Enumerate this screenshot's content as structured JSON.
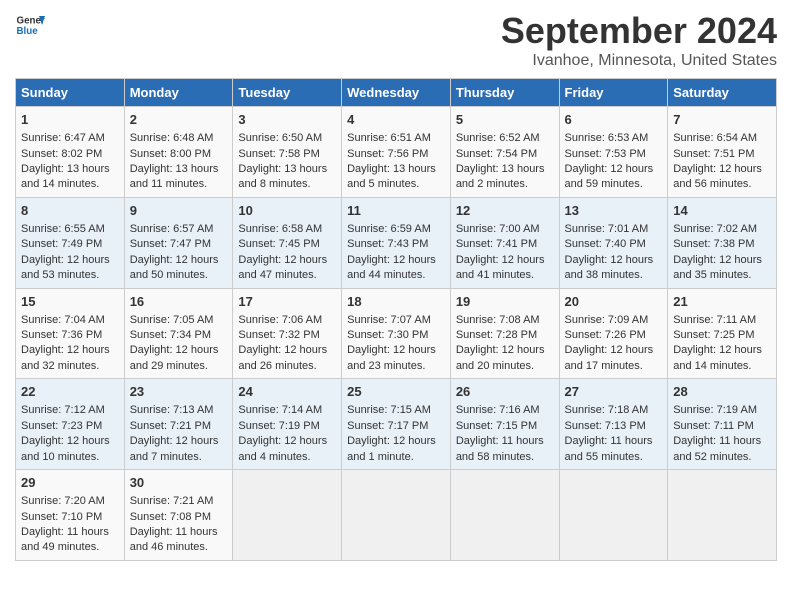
{
  "header": {
    "logo_line1": "General",
    "logo_line2": "Blue",
    "title": "September 2024",
    "subtitle": "Ivanhoe, Minnesota, United States"
  },
  "days_of_week": [
    "Sunday",
    "Monday",
    "Tuesday",
    "Wednesday",
    "Thursday",
    "Friday",
    "Saturday"
  ],
  "weeks": [
    [
      {
        "day": "1",
        "lines": [
          "Sunrise: 6:47 AM",
          "Sunset: 8:02 PM",
          "Daylight: 13 hours",
          "and 14 minutes."
        ]
      },
      {
        "day": "2",
        "lines": [
          "Sunrise: 6:48 AM",
          "Sunset: 8:00 PM",
          "Daylight: 13 hours",
          "and 11 minutes."
        ]
      },
      {
        "day": "3",
        "lines": [
          "Sunrise: 6:50 AM",
          "Sunset: 7:58 PM",
          "Daylight: 13 hours",
          "and 8 minutes."
        ]
      },
      {
        "day": "4",
        "lines": [
          "Sunrise: 6:51 AM",
          "Sunset: 7:56 PM",
          "Daylight: 13 hours",
          "and 5 minutes."
        ]
      },
      {
        "day": "5",
        "lines": [
          "Sunrise: 6:52 AM",
          "Sunset: 7:54 PM",
          "Daylight: 13 hours",
          "and 2 minutes."
        ]
      },
      {
        "day": "6",
        "lines": [
          "Sunrise: 6:53 AM",
          "Sunset: 7:53 PM",
          "Daylight: 12 hours",
          "and 59 minutes."
        ]
      },
      {
        "day": "7",
        "lines": [
          "Sunrise: 6:54 AM",
          "Sunset: 7:51 PM",
          "Daylight: 12 hours",
          "and 56 minutes."
        ]
      }
    ],
    [
      {
        "day": "8",
        "lines": [
          "Sunrise: 6:55 AM",
          "Sunset: 7:49 PM",
          "Daylight: 12 hours",
          "and 53 minutes."
        ]
      },
      {
        "day": "9",
        "lines": [
          "Sunrise: 6:57 AM",
          "Sunset: 7:47 PM",
          "Daylight: 12 hours",
          "and 50 minutes."
        ]
      },
      {
        "day": "10",
        "lines": [
          "Sunrise: 6:58 AM",
          "Sunset: 7:45 PM",
          "Daylight: 12 hours",
          "and 47 minutes."
        ]
      },
      {
        "day": "11",
        "lines": [
          "Sunrise: 6:59 AM",
          "Sunset: 7:43 PM",
          "Daylight: 12 hours",
          "and 44 minutes."
        ]
      },
      {
        "day": "12",
        "lines": [
          "Sunrise: 7:00 AM",
          "Sunset: 7:41 PM",
          "Daylight: 12 hours",
          "and 41 minutes."
        ]
      },
      {
        "day": "13",
        "lines": [
          "Sunrise: 7:01 AM",
          "Sunset: 7:40 PM",
          "Daylight: 12 hours",
          "and 38 minutes."
        ]
      },
      {
        "day": "14",
        "lines": [
          "Sunrise: 7:02 AM",
          "Sunset: 7:38 PM",
          "Daylight: 12 hours",
          "and 35 minutes."
        ]
      }
    ],
    [
      {
        "day": "15",
        "lines": [
          "Sunrise: 7:04 AM",
          "Sunset: 7:36 PM",
          "Daylight: 12 hours",
          "and 32 minutes."
        ]
      },
      {
        "day": "16",
        "lines": [
          "Sunrise: 7:05 AM",
          "Sunset: 7:34 PM",
          "Daylight: 12 hours",
          "and 29 minutes."
        ]
      },
      {
        "day": "17",
        "lines": [
          "Sunrise: 7:06 AM",
          "Sunset: 7:32 PM",
          "Daylight: 12 hours",
          "and 26 minutes."
        ]
      },
      {
        "day": "18",
        "lines": [
          "Sunrise: 7:07 AM",
          "Sunset: 7:30 PM",
          "Daylight: 12 hours",
          "and 23 minutes."
        ]
      },
      {
        "day": "19",
        "lines": [
          "Sunrise: 7:08 AM",
          "Sunset: 7:28 PM",
          "Daylight: 12 hours",
          "and 20 minutes."
        ]
      },
      {
        "day": "20",
        "lines": [
          "Sunrise: 7:09 AM",
          "Sunset: 7:26 PM",
          "Daylight: 12 hours",
          "and 17 minutes."
        ]
      },
      {
        "day": "21",
        "lines": [
          "Sunrise: 7:11 AM",
          "Sunset: 7:25 PM",
          "Daylight: 12 hours",
          "and 14 minutes."
        ]
      }
    ],
    [
      {
        "day": "22",
        "lines": [
          "Sunrise: 7:12 AM",
          "Sunset: 7:23 PM",
          "Daylight: 12 hours",
          "and 10 minutes."
        ]
      },
      {
        "day": "23",
        "lines": [
          "Sunrise: 7:13 AM",
          "Sunset: 7:21 PM",
          "Daylight: 12 hours",
          "and 7 minutes."
        ]
      },
      {
        "day": "24",
        "lines": [
          "Sunrise: 7:14 AM",
          "Sunset: 7:19 PM",
          "Daylight: 12 hours",
          "and 4 minutes."
        ]
      },
      {
        "day": "25",
        "lines": [
          "Sunrise: 7:15 AM",
          "Sunset: 7:17 PM",
          "Daylight: 12 hours",
          "and 1 minute."
        ]
      },
      {
        "day": "26",
        "lines": [
          "Sunrise: 7:16 AM",
          "Sunset: 7:15 PM",
          "Daylight: 11 hours",
          "and 58 minutes."
        ]
      },
      {
        "day": "27",
        "lines": [
          "Sunrise: 7:18 AM",
          "Sunset: 7:13 PM",
          "Daylight: 11 hours",
          "and 55 minutes."
        ]
      },
      {
        "day": "28",
        "lines": [
          "Sunrise: 7:19 AM",
          "Sunset: 7:11 PM",
          "Daylight: 11 hours",
          "and 52 minutes."
        ]
      }
    ],
    [
      {
        "day": "29",
        "lines": [
          "Sunrise: 7:20 AM",
          "Sunset: 7:10 PM",
          "Daylight: 11 hours",
          "and 49 minutes."
        ]
      },
      {
        "day": "30",
        "lines": [
          "Sunrise: 7:21 AM",
          "Sunset: 7:08 PM",
          "Daylight: 11 hours",
          "and 46 minutes."
        ]
      },
      null,
      null,
      null,
      null,
      null
    ]
  ]
}
